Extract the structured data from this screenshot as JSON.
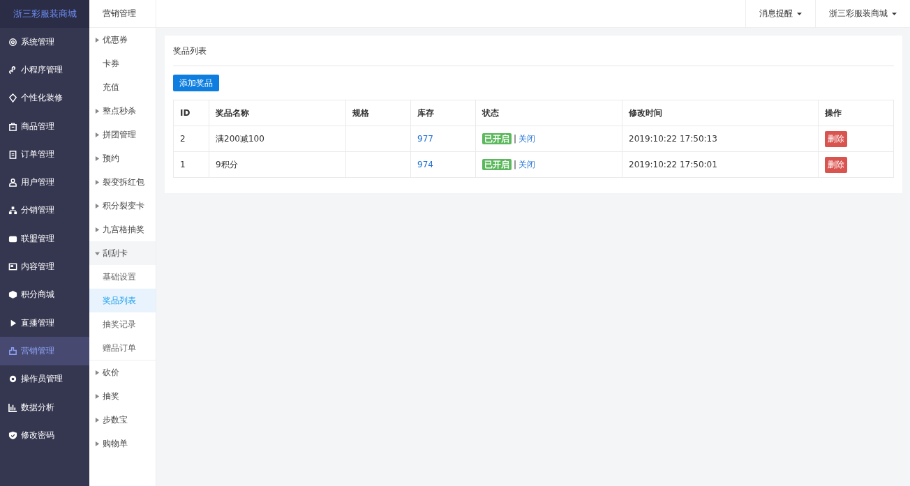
{
  "brand": "浙三彩服装商城",
  "sidebar": {
    "items": [
      {
        "label": "系统管理",
        "selected": false
      },
      {
        "label": "小程序管理",
        "selected": false
      },
      {
        "label": "个性化装修",
        "selected": false
      },
      {
        "label": "商品管理",
        "selected": false
      },
      {
        "label": "订单管理",
        "selected": false
      },
      {
        "label": "用户管理",
        "selected": false
      },
      {
        "label": "分销管理",
        "selected": false
      },
      {
        "label": "联盟管理",
        "selected": false
      },
      {
        "label": "内容管理",
        "selected": false
      },
      {
        "label": "积分商城",
        "selected": false
      },
      {
        "label": "直播管理",
        "selected": false
      },
      {
        "label": "营销管理",
        "selected": true
      },
      {
        "label": "操作员管理",
        "selected": false
      },
      {
        "label": "数据分析",
        "selected": false
      },
      {
        "label": "修改密码",
        "selected": false
      }
    ]
  },
  "submenu": {
    "title": "营销管理",
    "items": [
      {
        "label": "优惠券",
        "kind": "group",
        "expanded": false
      },
      {
        "label": "卡券",
        "kind": "link"
      },
      {
        "label": "充值",
        "kind": "link"
      },
      {
        "label": "整点秒杀",
        "kind": "group",
        "expanded": false
      },
      {
        "label": "拼团管理",
        "kind": "group",
        "expanded": false
      },
      {
        "label": "预约",
        "kind": "group",
        "expanded": false
      },
      {
        "label": "裂变拆红包",
        "kind": "group",
        "expanded": false
      },
      {
        "label": "积分裂变卡",
        "kind": "group",
        "expanded": false
      },
      {
        "label": "九宫格抽奖",
        "kind": "group",
        "expanded": false
      },
      {
        "label": "刮刮卡",
        "kind": "group",
        "expanded": true,
        "children": [
          {
            "label": "基础设置",
            "selected": false
          },
          {
            "label": "奖品列表",
            "selected": true
          },
          {
            "label": "抽奖记录",
            "selected": false
          },
          {
            "label": "赠品订单",
            "selected": false
          }
        ]
      },
      {
        "label": "砍价",
        "kind": "group",
        "expanded": false
      },
      {
        "label": "抽奖",
        "kind": "group",
        "expanded": false
      },
      {
        "label": "步数宝",
        "kind": "group",
        "expanded": false
      },
      {
        "label": "购物单",
        "kind": "group",
        "expanded": false
      }
    ]
  },
  "topbar": {
    "menus": [
      "消息提醒",
      "浙三彩服装商城"
    ]
  },
  "panel": {
    "title": "奖品列表",
    "add_button": "添加奖品",
    "table": {
      "columns": [
        "ID",
        "奖品名称",
        "规格",
        "库存",
        "状态",
        "修改时间",
        "操作"
      ],
      "rows": [
        {
          "id": "2",
          "name": "满200减100",
          "stock": "977",
          "status": "已开启",
          "enabled": true,
          "separator": "|",
          "toggle": "关闭",
          "time": "2019:10:22 17:50:13",
          "action": "删除"
        },
        {
          "id": "1",
          "name": "9积分",
          "stock": "974",
          "status": "已开启",
          "enabled": true,
          "separator": "|",
          "toggle": "关闭",
          "time": "2019:10:22 17:50:01",
          "action": "删除"
        }
      ]
    }
  }
}
